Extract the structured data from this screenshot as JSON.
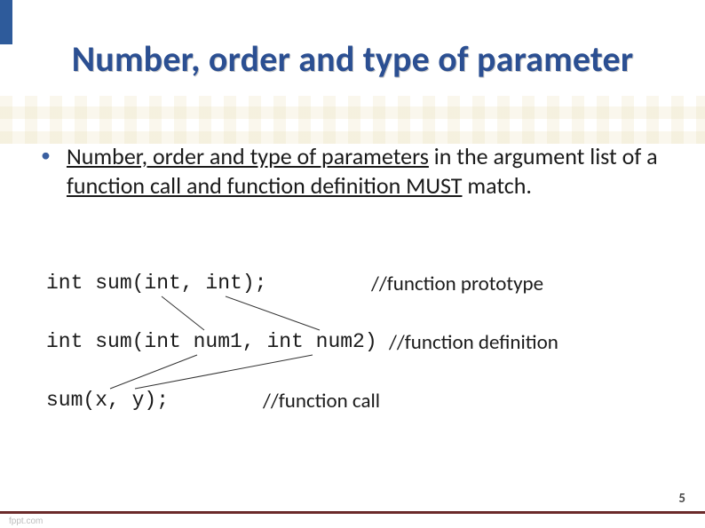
{
  "title": "Number, order and type of parameter",
  "bullet": {
    "part1": "Number, order and type of parameters",
    "part2": " in the argument list of a ",
    "part3": "function call and function definition MUST",
    "part4": " match."
  },
  "code": {
    "line1": "int sum(int, int);",
    "line2": "int sum(int num1, int num2)",
    "line3": "sum(x, y);"
  },
  "comments": {
    "c1": "//function prototype",
    "c2": "//function definition",
    "c3": "//function call"
  },
  "slide_number": "5",
  "watermark": "fppt.com"
}
